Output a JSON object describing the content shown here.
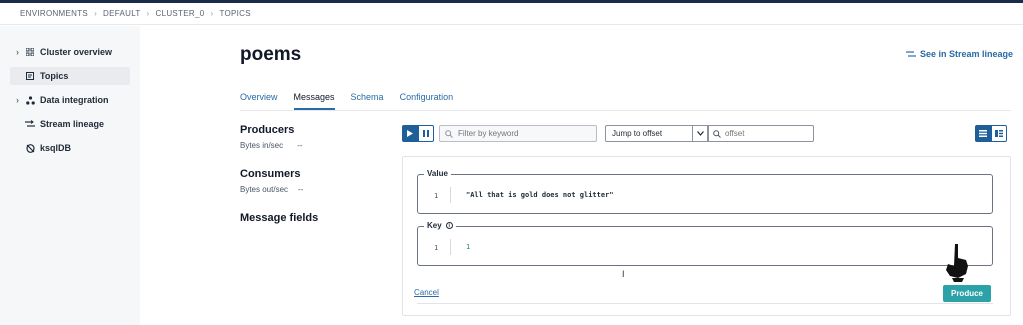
{
  "breadcrumb": [
    "ENVIRONMENTS",
    "DEFAULT",
    "CLUSTER_0",
    "TOPICS"
  ],
  "sidebar": {
    "items": [
      {
        "label": "Cluster overview",
        "icon": "grid-icon",
        "expandable": true
      },
      {
        "label": "Topics",
        "icon": "topics-icon",
        "expandable": false,
        "active": true
      },
      {
        "label": "Data integration",
        "icon": "integration-icon",
        "expandable": true
      },
      {
        "label": "Stream lineage",
        "icon": "lineage-icon",
        "expandable": false
      },
      {
        "label": "ksqlDB",
        "icon": "ksqldb-icon",
        "expandable": false
      }
    ]
  },
  "page": {
    "title": "poems",
    "lineage_link": "See in Stream lineage",
    "tabs": [
      "Overview",
      "Messages",
      "Schema",
      "Configuration"
    ],
    "active_tab": "Messages"
  },
  "stats": {
    "producers_title": "Producers",
    "bytes_in_label": "Bytes in/sec",
    "bytes_in_value": "--",
    "consumers_title": "Consumers",
    "bytes_out_label": "Bytes out/sec",
    "bytes_out_value": "--",
    "message_fields_title": "Message fields"
  },
  "toolbar": {
    "filter_placeholder": "Filter by keyword",
    "jump_label": "Jump to offset",
    "offset_placeholder": "offset"
  },
  "producer": {
    "value_legend": "Value",
    "value_line_number": "1",
    "value_code": "\"All that is gold does not glitter\"",
    "key_legend": "Key",
    "key_line_number": "1",
    "key_code": "1",
    "cancel_label": "Cancel",
    "produce_label": "Produce"
  },
  "colors": {
    "accent": "#1e5f99",
    "link": "#2a6aa6",
    "produce_button": "#2aa2a8",
    "sidebar_bg": "#f6f7f9"
  }
}
